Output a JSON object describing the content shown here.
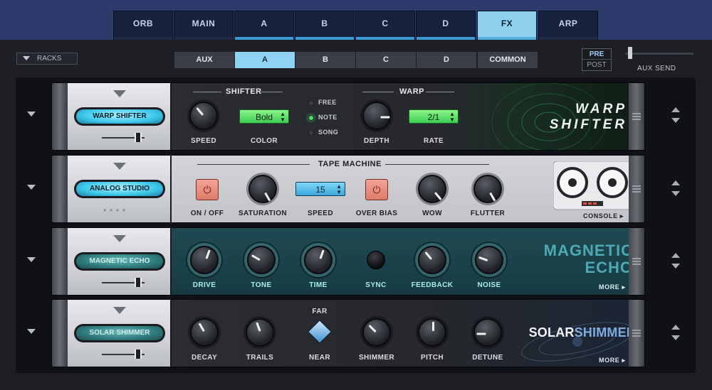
{
  "top_tabs": [
    "ORB",
    "MAIN",
    "A",
    "B",
    "C",
    "D",
    "FX",
    "ARP"
  ],
  "top_tabs_active": "FX",
  "racks_label": "RACKS",
  "sub_tabs": [
    "AUX",
    "A",
    "B",
    "C",
    "D",
    "COMMON"
  ],
  "sub_tabs_active": "A",
  "pre_label": "PRE",
  "post_label": "POST",
  "aux_send_label": "AUX SEND",
  "aux_send_level": 0.05,
  "modules": {
    "warp_shifter": {
      "name": "WARP SHIFTER",
      "logo_line1": "WARP",
      "logo_line2": "SHIFTER",
      "shifter_section": "SHIFTER",
      "warp_section": "WARP",
      "speed_label": "SPEED",
      "color_label": "COLOR",
      "color_value": "Bold",
      "sync_modes": [
        "FREE",
        "NOTE",
        "SONG"
      ],
      "sync_selected": "NOTE",
      "depth_label": "DEPTH",
      "rate_label": "RATE",
      "rate_value": "2/1"
    },
    "analog_studio": {
      "name": "ANALOG STUDIO",
      "section": "TAPE MACHINE",
      "onoff_label": "ON / OFF",
      "saturation_label": "SATURATION",
      "speed_label": "SPEED",
      "speed_value": "15",
      "overbias_label": "OVER BIAS",
      "wow_label": "WOW",
      "flutter_label": "FLUTTER",
      "console_label": "CONSOLE ▸"
    },
    "magnetic_echo": {
      "name": "MAGNETIC ECHO",
      "logo_line1": "MAGNETIC",
      "logo_line2": "ECHO",
      "drive_label": "DRIVE",
      "tone_label": "TONE",
      "time_label": "TIME",
      "sync_label": "SYNC",
      "feedback_label": "FEEDBACK",
      "noise_label": "NOISE",
      "more_label": "MORE ▸"
    },
    "solar_shimmer": {
      "name": "SOLAR SHIMMER",
      "logo_a": "SOLAR",
      "logo_b": "SHIMMER",
      "decay_label": "DECAY",
      "trails_label": "TRAILS",
      "far_label": "FAR",
      "near_label": "NEAR",
      "shimmer_label": "SHIMMER",
      "pitch_label": "PITCH",
      "detune_label": "DETUNE",
      "more_label": "MORE ▸"
    }
  },
  "colors": {
    "accent_cyan": "#8ed2f0",
    "lcd_green": "#5fe06a",
    "top_bar": "#2d3a6c"
  }
}
